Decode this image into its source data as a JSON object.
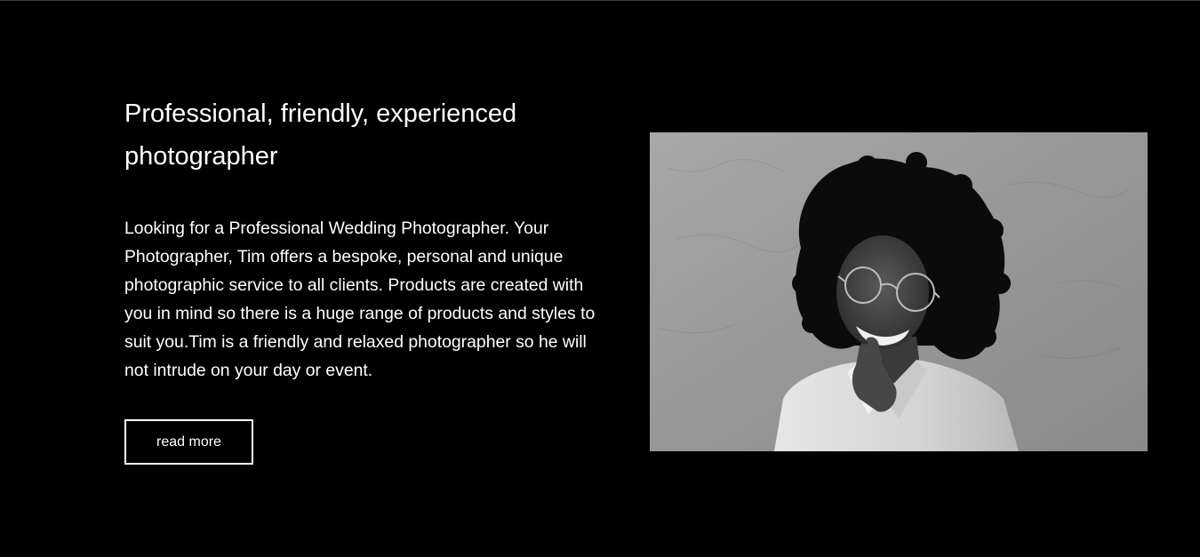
{
  "intro": {
    "headline": "Professional, friendly, experienced photographer",
    "body": "Looking for a Professional Wedding Photographer. Your Photographer, Tim offers a bespoke, personal and unique photographic service to all clients. Products are created with you in mind so there is a huge range of products and styles to suit you.Tim is a friendly and relaxed photographer so he will not intrude on your day or event.",
    "button_label": "read more"
  },
  "colors": {
    "background": "#000000",
    "text": "#ffffff",
    "button_border": "#ffffff"
  },
  "portrait": {
    "style": "black-and-white"
  }
}
